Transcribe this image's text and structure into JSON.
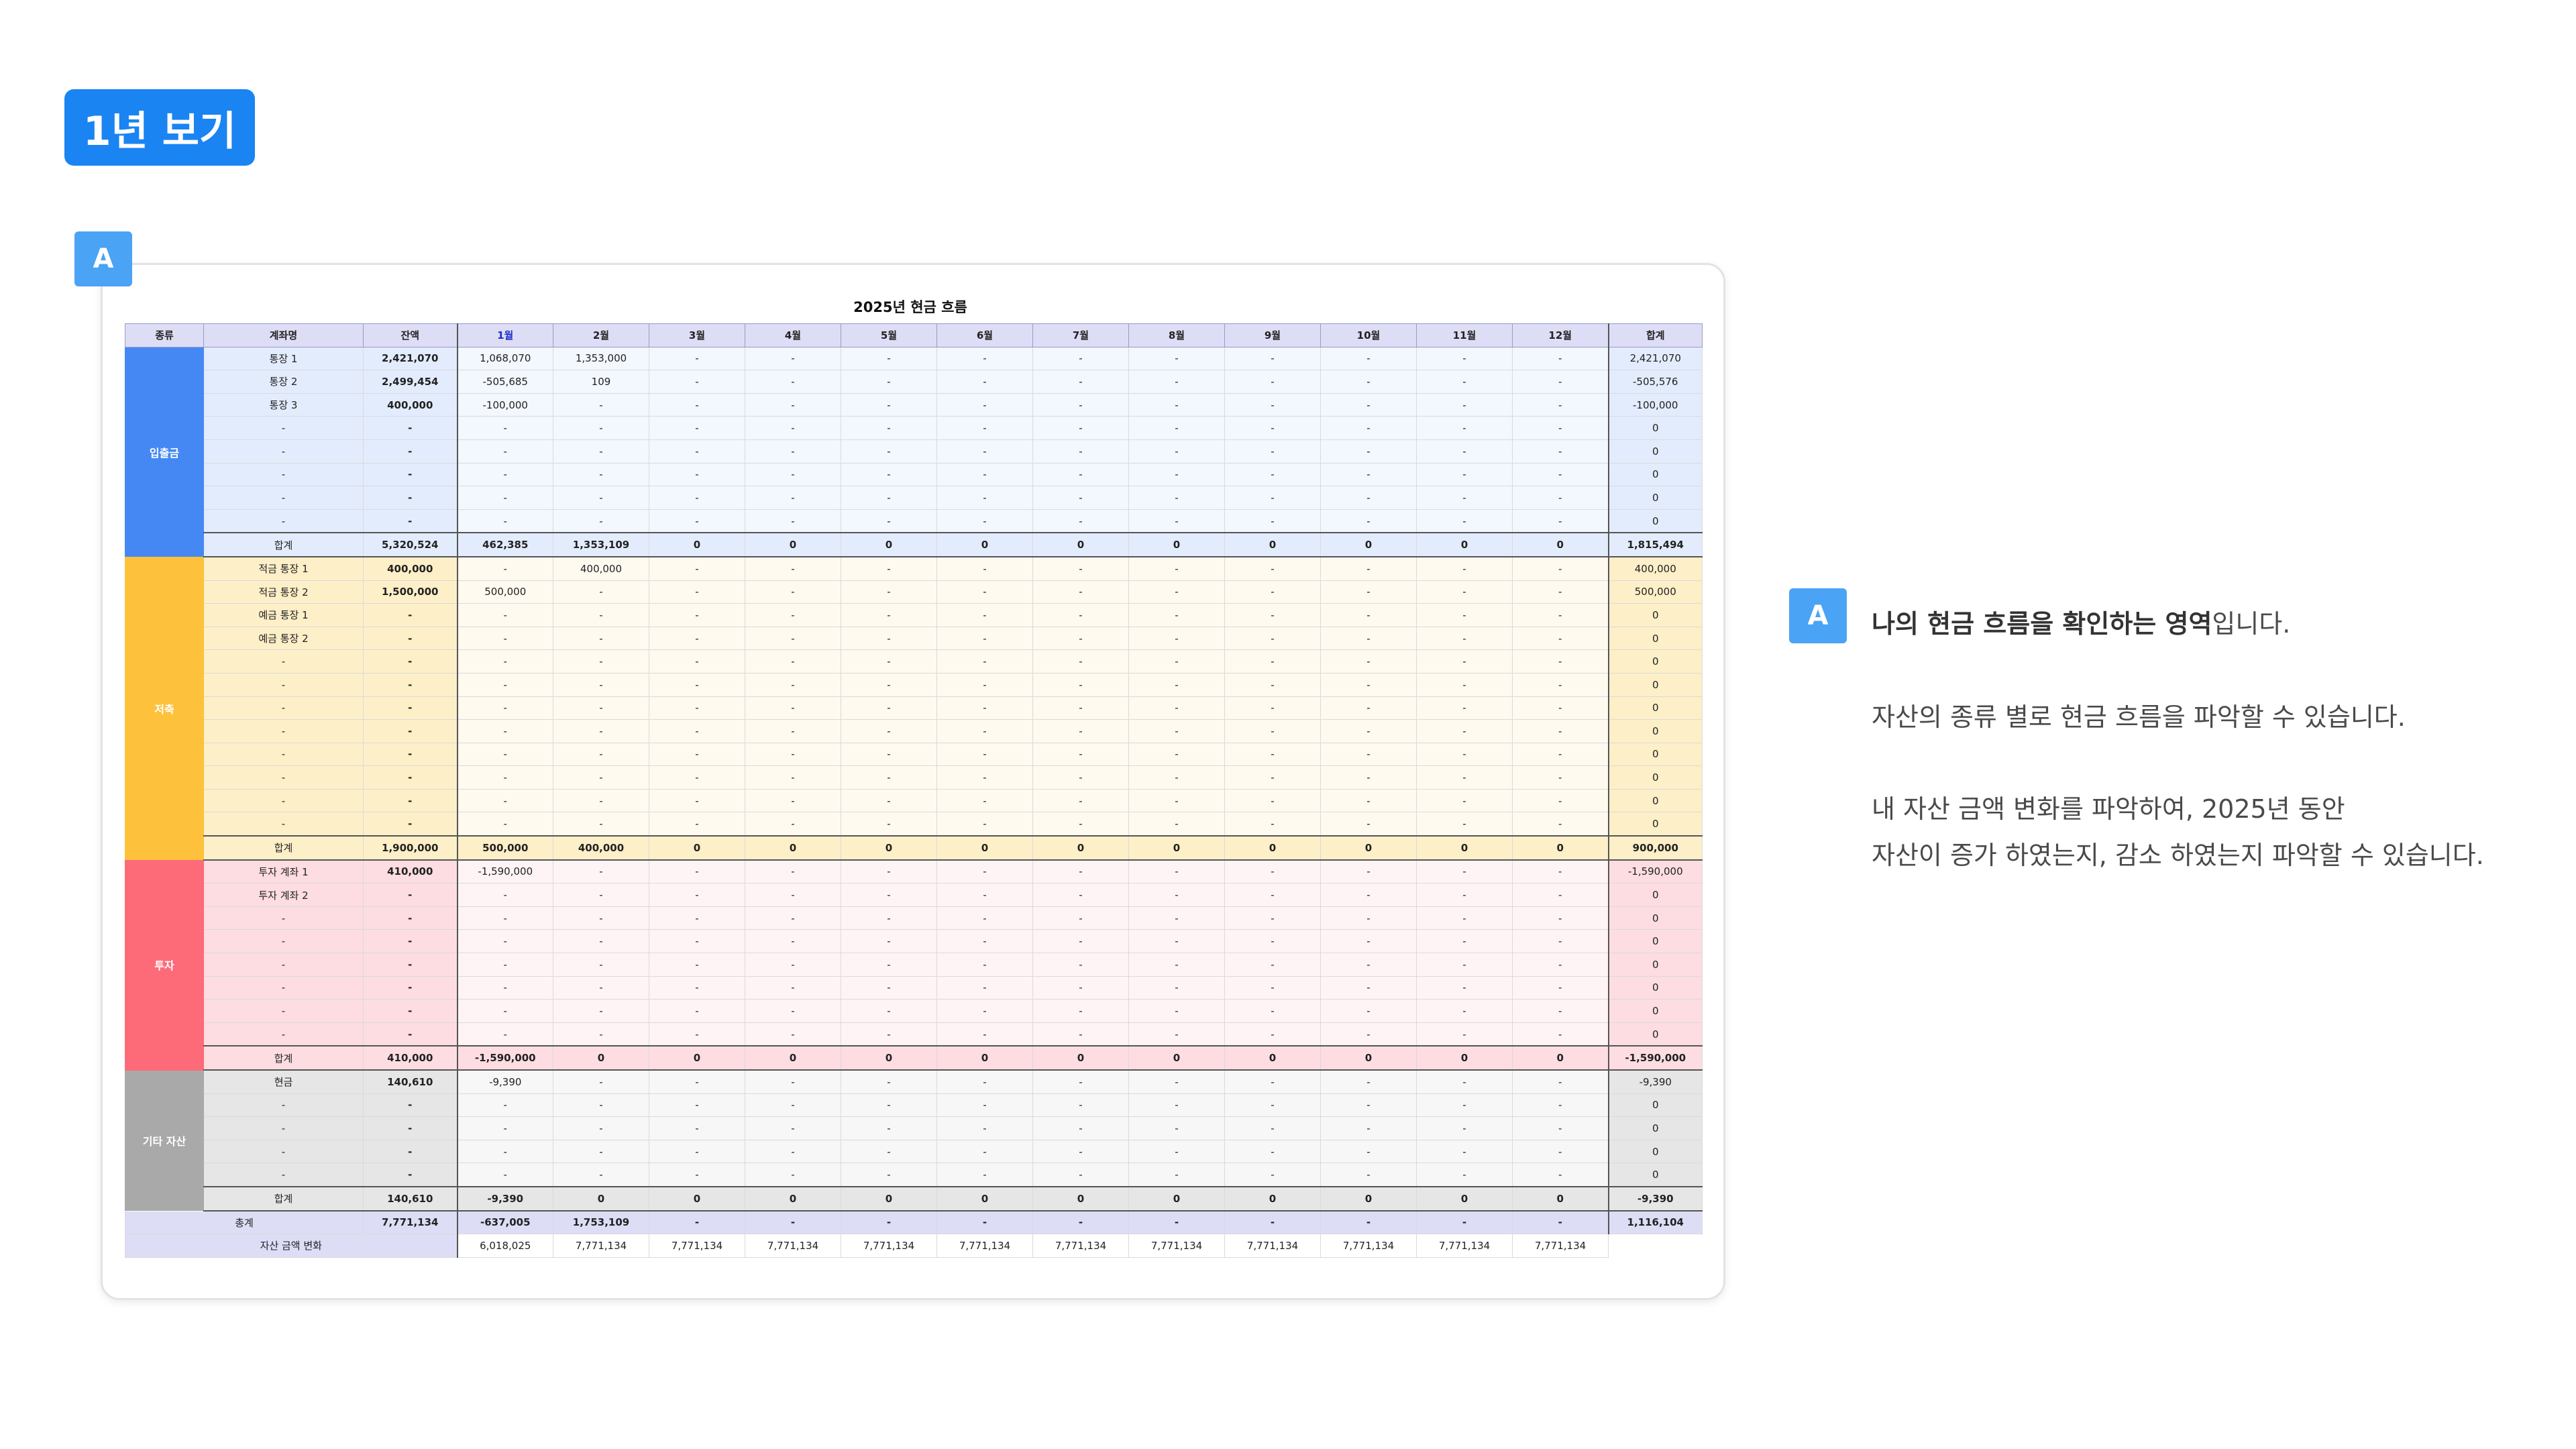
{
  "page_title": "1년 보기",
  "marker_label": "A",
  "sheet": {
    "title": "2025년 현금 흐름",
    "headers": [
      "종류",
      "계좌명",
      "잔액",
      "1월",
      "2월",
      "3월",
      "4월",
      "5월",
      "6월",
      "7월",
      "8월",
      "9월",
      "10월",
      "11월",
      "12월",
      "합계"
    ],
    "groups": [
      {
        "name": "입출금",
        "color": "#4688f3",
        "tint": "#e3ecfd",
        "month_tint": "#f3f7fe",
        "rows": [
          [
            "통장 1",
            "2,421,070",
            "1,068,070",
            "1,353,000",
            "-",
            "-",
            "-",
            "-",
            "-",
            "-",
            "-",
            "-",
            "-",
            "-",
            "2,421,070"
          ],
          [
            "통장 2",
            "2,499,454",
            "-505,685",
            "109",
            "-",
            "-",
            "-",
            "-",
            "-",
            "-",
            "-",
            "-",
            "-",
            "-",
            "-505,576"
          ],
          [
            "통장 3",
            "400,000",
            "-100,000",
            "-",
            "-",
            "-",
            "-",
            "-",
            "-",
            "-",
            "-",
            "-",
            "-",
            "-",
            "-100,000"
          ],
          [
            "-",
            "-",
            "-",
            "-",
            "-",
            "-",
            "-",
            "-",
            "-",
            "-",
            "-",
            "-",
            "-",
            "-",
            "0"
          ],
          [
            "-",
            "-",
            "-",
            "-",
            "-",
            "-",
            "-",
            "-",
            "-",
            "-",
            "-",
            "-",
            "-",
            "-",
            "0"
          ],
          [
            "-",
            "-",
            "-",
            "-",
            "-",
            "-",
            "-",
            "-",
            "-",
            "-",
            "-",
            "-",
            "-",
            "-",
            "0"
          ],
          [
            "-",
            "-",
            "-",
            "-",
            "-",
            "-",
            "-",
            "-",
            "-",
            "-",
            "-",
            "-",
            "-",
            "-",
            "0"
          ],
          [
            "-",
            "-",
            "-",
            "-",
            "-",
            "-",
            "-",
            "-",
            "-",
            "-",
            "-",
            "-",
            "-",
            "-",
            "0"
          ]
        ],
        "subtotal": [
          "합계",
          "5,320,524",
          "462,385",
          "1,353,109",
          "0",
          "0",
          "0",
          "0",
          "0",
          "0",
          "0",
          "0",
          "0",
          "0",
          "1,815,494"
        ]
      },
      {
        "name": "저축",
        "color": "#fdc13b",
        "tint": "#fdefc8",
        "month_tint": "#fffaf0",
        "rows": [
          [
            "적금 통장 1",
            "400,000",
            "-",
            "400,000",
            "-",
            "-",
            "-",
            "-",
            "-",
            "-",
            "-",
            "-",
            "-",
            "-",
            "400,000"
          ],
          [
            "적금 통장 2",
            "1,500,000",
            "500,000",
            "-",
            "-",
            "-",
            "-",
            "-",
            "-",
            "-",
            "-",
            "-",
            "-",
            "-",
            "500,000"
          ],
          [
            "예금 통장 1",
            "-",
            "-",
            "-",
            "-",
            "-",
            "-",
            "-",
            "-",
            "-",
            "-",
            "-",
            "-",
            "-",
            "0"
          ],
          [
            "예금 통장 2",
            "-",
            "-",
            "-",
            "-",
            "-",
            "-",
            "-",
            "-",
            "-",
            "-",
            "-",
            "-",
            "-",
            "0"
          ],
          [
            "-",
            "-",
            "-",
            "-",
            "-",
            "-",
            "-",
            "-",
            "-",
            "-",
            "-",
            "-",
            "-",
            "-",
            "0"
          ],
          [
            "-",
            "-",
            "-",
            "-",
            "-",
            "-",
            "-",
            "-",
            "-",
            "-",
            "-",
            "-",
            "-",
            "-",
            "0"
          ],
          [
            "-",
            "-",
            "-",
            "-",
            "-",
            "-",
            "-",
            "-",
            "-",
            "-",
            "-",
            "-",
            "-",
            "-",
            "0"
          ],
          [
            "-",
            "-",
            "-",
            "-",
            "-",
            "-",
            "-",
            "-",
            "-",
            "-",
            "-",
            "-",
            "-",
            "-",
            "0"
          ],
          [
            "-",
            "-",
            "-",
            "-",
            "-",
            "-",
            "-",
            "-",
            "-",
            "-",
            "-",
            "-",
            "-",
            "-",
            "0"
          ],
          [
            "-",
            "-",
            "-",
            "-",
            "-",
            "-",
            "-",
            "-",
            "-",
            "-",
            "-",
            "-",
            "-",
            "-",
            "0"
          ],
          [
            "-",
            "-",
            "-",
            "-",
            "-",
            "-",
            "-",
            "-",
            "-",
            "-",
            "-",
            "-",
            "-",
            "-",
            "0"
          ],
          [
            "-",
            "-",
            "-",
            "-",
            "-",
            "-",
            "-",
            "-",
            "-",
            "-",
            "-",
            "-",
            "-",
            "-",
            "0"
          ]
        ],
        "subtotal": [
          "합계",
          "1,900,000",
          "500,000",
          "400,000",
          "0",
          "0",
          "0",
          "0",
          "0",
          "0",
          "0",
          "0",
          "0",
          "0",
          "900,000"
        ]
      },
      {
        "name": "투자",
        "color": "#fd6b78",
        "tint": "#fddde1",
        "month_tint": "#fff4f5",
        "rows": [
          [
            "투자 계좌 1",
            "410,000",
            "-1,590,000",
            "-",
            "-",
            "-",
            "-",
            "-",
            "-",
            "-",
            "-",
            "-",
            "-",
            "-",
            "-1,590,000"
          ],
          [
            "투자 계좌 2",
            "-",
            "-",
            "-",
            "-",
            "-",
            "-",
            "-",
            "-",
            "-",
            "-",
            "-",
            "-",
            "-",
            "0"
          ],
          [
            "-",
            "-",
            "-",
            "-",
            "-",
            "-",
            "-",
            "-",
            "-",
            "-",
            "-",
            "-",
            "-",
            "-",
            "0"
          ],
          [
            "-",
            "-",
            "-",
            "-",
            "-",
            "-",
            "-",
            "-",
            "-",
            "-",
            "-",
            "-",
            "-",
            "-",
            "0"
          ],
          [
            "-",
            "-",
            "-",
            "-",
            "-",
            "-",
            "-",
            "-",
            "-",
            "-",
            "-",
            "-",
            "-",
            "-",
            "0"
          ],
          [
            "-",
            "-",
            "-",
            "-",
            "-",
            "-",
            "-",
            "-",
            "-",
            "-",
            "-",
            "-",
            "-",
            "-",
            "0"
          ],
          [
            "-",
            "-",
            "-",
            "-",
            "-",
            "-",
            "-",
            "-",
            "-",
            "-",
            "-",
            "-",
            "-",
            "-",
            "0"
          ],
          [
            "-",
            "-",
            "-",
            "-",
            "-",
            "-",
            "-",
            "-",
            "-",
            "-",
            "-",
            "-",
            "-",
            "-",
            "0"
          ]
        ],
        "subtotal": [
          "합계",
          "410,000",
          "-1,590,000",
          "0",
          "0",
          "0",
          "0",
          "0",
          "0",
          "0",
          "0",
          "0",
          "0",
          "0",
          "-1,590,000"
        ]
      },
      {
        "name": "기타 자산",
        "color": "#a9a9a9",
        "tint": "#e6e6e6",
        "month_tint": "#f7f7f7",
        "rows": [
          [
            "현금",
            "140,610",
            "-9,390",
            "-",
            "-",
            "-",
            "-",
            "-",
            "-",
            "-",
            "-",
            "-",
            "-",
            "-",
            "-9,390"
          ],
          [
            "-",
            "-",
            "-",
            "-",
            "-",
            "-",
            "-",
            "-",
            "-",
            "-",
            "-",
            "-",
            "-",
            "-",
            "0"
          ],
          [
            "-",
            "-",
            "-",
            "-",
            "-",
            "-",
            "-",
            "-",
            "-",
            "-",
            "-",
            "-",
            "-",
            "-",
            "0"
          ],
          [
            "-",
            "-",
            "-",
            "-",
            "-",
            "-",
            "-",
            "-",
            "-",
            "-",
            "-",
            "-",
            "-",
            "-",
            "0"
          ],
          [
            "-",
            "-",
            "-",
            "-",
            "-",
            "-",
            "-",
            "-",
            "-",
            "-",
            "-",
            "-",
            "-",
            "-",
            "0"
          ]
        ],
        "subtotal": [
          "합계",
          "140,610",
          "-9,390",
          "0",
          "0",
          "0",
          "0",
          "0",
          "0",
          "0",
          "0",
          "0",
          "0",
          "0",
          "-9,390"
        ]
      }
    ],
    "total_row": [
      "총계",
      "7,771,134",
      "-637,005",
      "1,753,109",
      "-",
      "-",
      "-",
      "-",
      "-",
      "-",
      "-",
      "-",
      "-",
      "-",
      "1,116,104"
    ],
    "change_row": [
      "자산 금액 변화",
      "6,018,025",
      "7,771,134",
      "7,771,134",
      "7,771,134",
      "7,771,134",
      "7,771,134",
      "7,771,134",
      "7,771,134",
      "7,771,134",
      "7,771,134",
      "7,771,134",
      "7,771,134"
    ]
  },
  "description": {
    "headline_bold": "나의 현금 흐름을 확인하는 영역",
    "headline_rest": "입니다.",
    "line1": "자산의 종류 별로 현금 흐름을 파악할 수 있습니다.",
    "line2": "내 자산 금액 변화를 파악하여, 2025년 동안",
    "line3": "자산이 증가 하였는지, 감소 하였는지 파악할 수 있습니다."
  },
  "colors": {
    "brand_blue": "#1a84f2",
    "marker_blue": "#4aa3f5",
    "header_bg": "#ddddf6"
  }
}
